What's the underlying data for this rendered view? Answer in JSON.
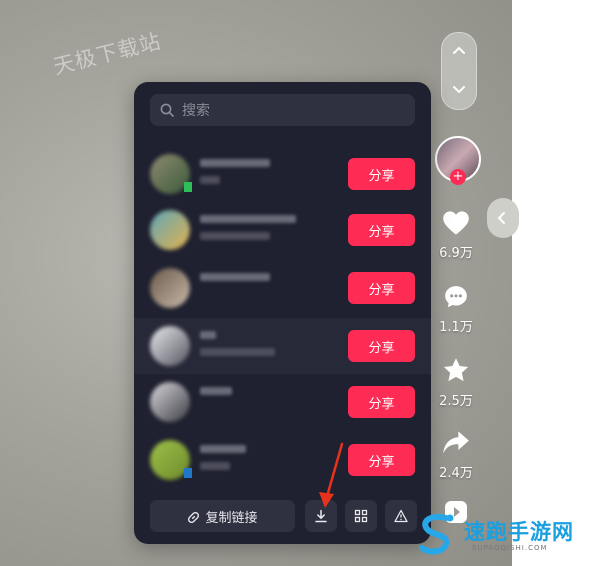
{
  "watermark": {
    "top_left": "天极下载站",
    "bottom_right_cn": "速跑手游网",
    "bottom_right_en": "SUPAOQISHI.COM"
  },
  "search": {
    "placeholder": "搜索",
    "icon": "search-icon"
  },
  "contacts": [
    {
      "share_label": "分享",
      "avatar_colors": [
        "#8d8b70",
        "#3c5a3a"
      ],
      "badge": "#2fbf59"
    },
    {
      "share_label": "分享",
      "avatar_colors": [
        "#5fa6b8",
        "#e3b24e"
      ]
    },
    {
      "share_label": "分享",
      "avatar_colors": [
        "#6a5a4c",
        "#c9b9a8"
      ]
    },
    {
      "share_label": "分享",
      "avatar_colors": [
        "#e9e9ee",
        "#555560"
      ]
    },
    {
      "share_label": "分享",
      "avatar_colors": [
        "#d8d8dc",
        "#3d3d45"
      ]
    },
    {
      "share_label": "分享",
      "avatar_colors": [
        "#9fc14a",
        "#6d8a2a"
      ],
      "badge": "#2277c8"
    }
  ],
  "footer": {
    "copy_link": "复制链接",
    "download_icon": "download-icon",
    "grid_icon": "qr-grid-icon",
    "report_icon": "warning-icon"
  },
  "side_actions": {
    "like": "6.9万",
    "comment": "1.1万",
    "favorite": "2.5万",
    "share": "2.4万"
  },
  "colors": {
    "accent": "#fe2c55",
    "panel": "#1f2030",
    "arrow": "#e8331c"
  }
}
